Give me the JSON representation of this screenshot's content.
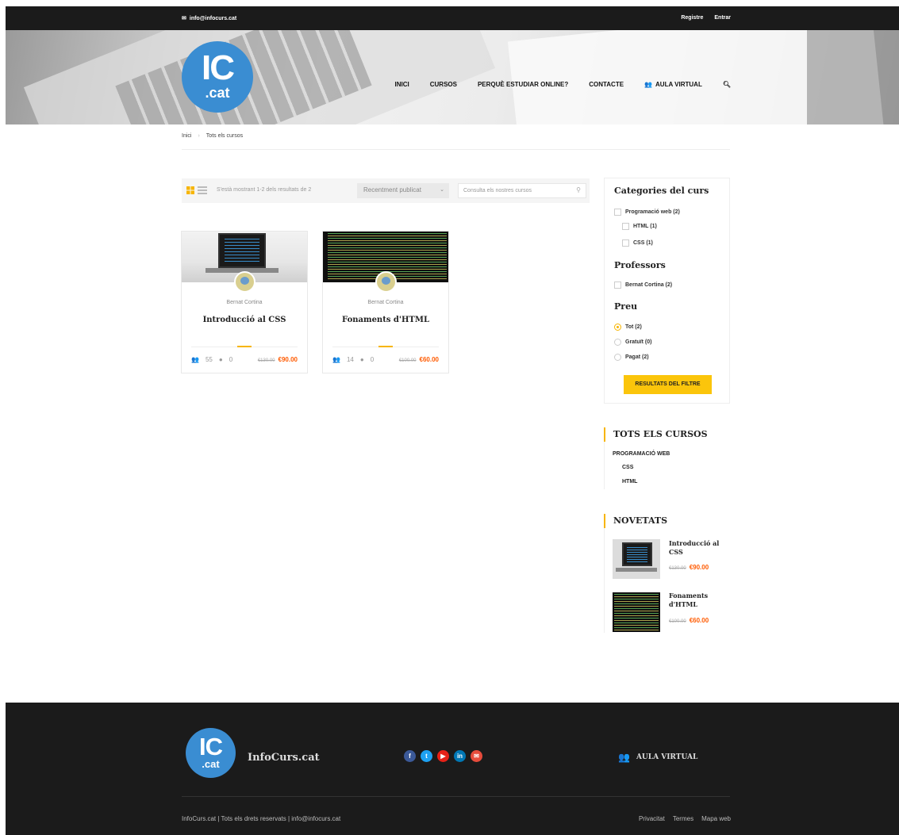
{
  "topbar": {
    "email": "info@infocurs.cat",
    "register": "Registre",
    "login": "Entrar"
  },
  "logo": {
    "main": "IC",
    "sub": ".cat"
  },
  "nav": {
    "items": [
      "INICI",
      "CURSOS",
      "PERQUÈ ESTUDIAR ONLINE?",
      "CONTACTE"
    ],
    "aula": "AULA VIRTUAL"
  },
  "breadcrumb": {
    "home": "Inici",
    "current": "Tots els cursos"
  },
  "toolbar": {
    "count": "S'està mostrant 1-2 dels resultats de 2",
    "sort_selected": "Recentment publicat",
    "search_placeholder": "Consulta els nostres cursos"
  },
  "courses": [
    {
      "author": "Bernat Cortina",
      "title": "Introducció al CSS",
      "students": "55",
      "comments": "0",
      "old_price": "€130.00",
      "price": "€90.00"
    },
    {
      "author": "Bernat Cortina",
      "title": "Fonaments d'HTML",
      "students": "14",
      "comments": "0",
      "old_price": "€100.00",
      "price": "€60.00"
    }
  ],
  "filter": {
    "categories_title": "Categories del curs",
    "categories": [
      "Programació web (2)",
      "HTML (1)",
      "CSS (1)"
    ],
    "teachers_title": "Professors",
    "teachers": [
      "Bernat Cortina (2)"
    ],
    "price_title": "Preu",
    "prices": [
      "Tot (2)",
      "Gratuït (0)",
      "Pagat (2)"
    ],
    "price_selected": "Tot (2)",
    "button": "RESULTATS DEL FILTRE"
  },
  "all_courses": {
    "title": "TOTS ELS CURSOS",
    "parent": "PROGRAMACIÓ WEB",
    "children": [
      "CSS",
      "HTML"
    ]
  },
  "news": {
    "title": "NOVETATS",
    "items": [
      {
        "title": "Introducció al CSS",
        "old_price": "€130.00",
        "price": "€90.00"
      },
      {
        "title": "Fonaments d'HTML",
        "old_price": "€100.00",
        "price": "€60.00"
      }
    ]
  },
  "footer": {
    "brand": "InfoCurs.cat",
    "aula": "AULA VIRTUAL",
    "social": [
      "facebook-icon",
      "twitter-icon",
      "youtube-icon",
      "linkedin-icon",
      "email-icon"
    ],
    "social_colors": [
      "#3b5998",
      "#1da1f2",
      "#e62117",
      "#0077b5",
      "#e74c3c"
    ],
    "copyright": "InfoCurs.cat | Tots els drets reservats | info@infocurs.cat",
    "links": [
      "Privacitat",
      "Termes",
      "Mapa web"
    ]
  },
  "colors": {
    "accent": "#f7b500",
    "price": "#ff5a00",
    "brand_blue": "#3a8dd2",
    "dark": "#1b1b1b"
  }
}
